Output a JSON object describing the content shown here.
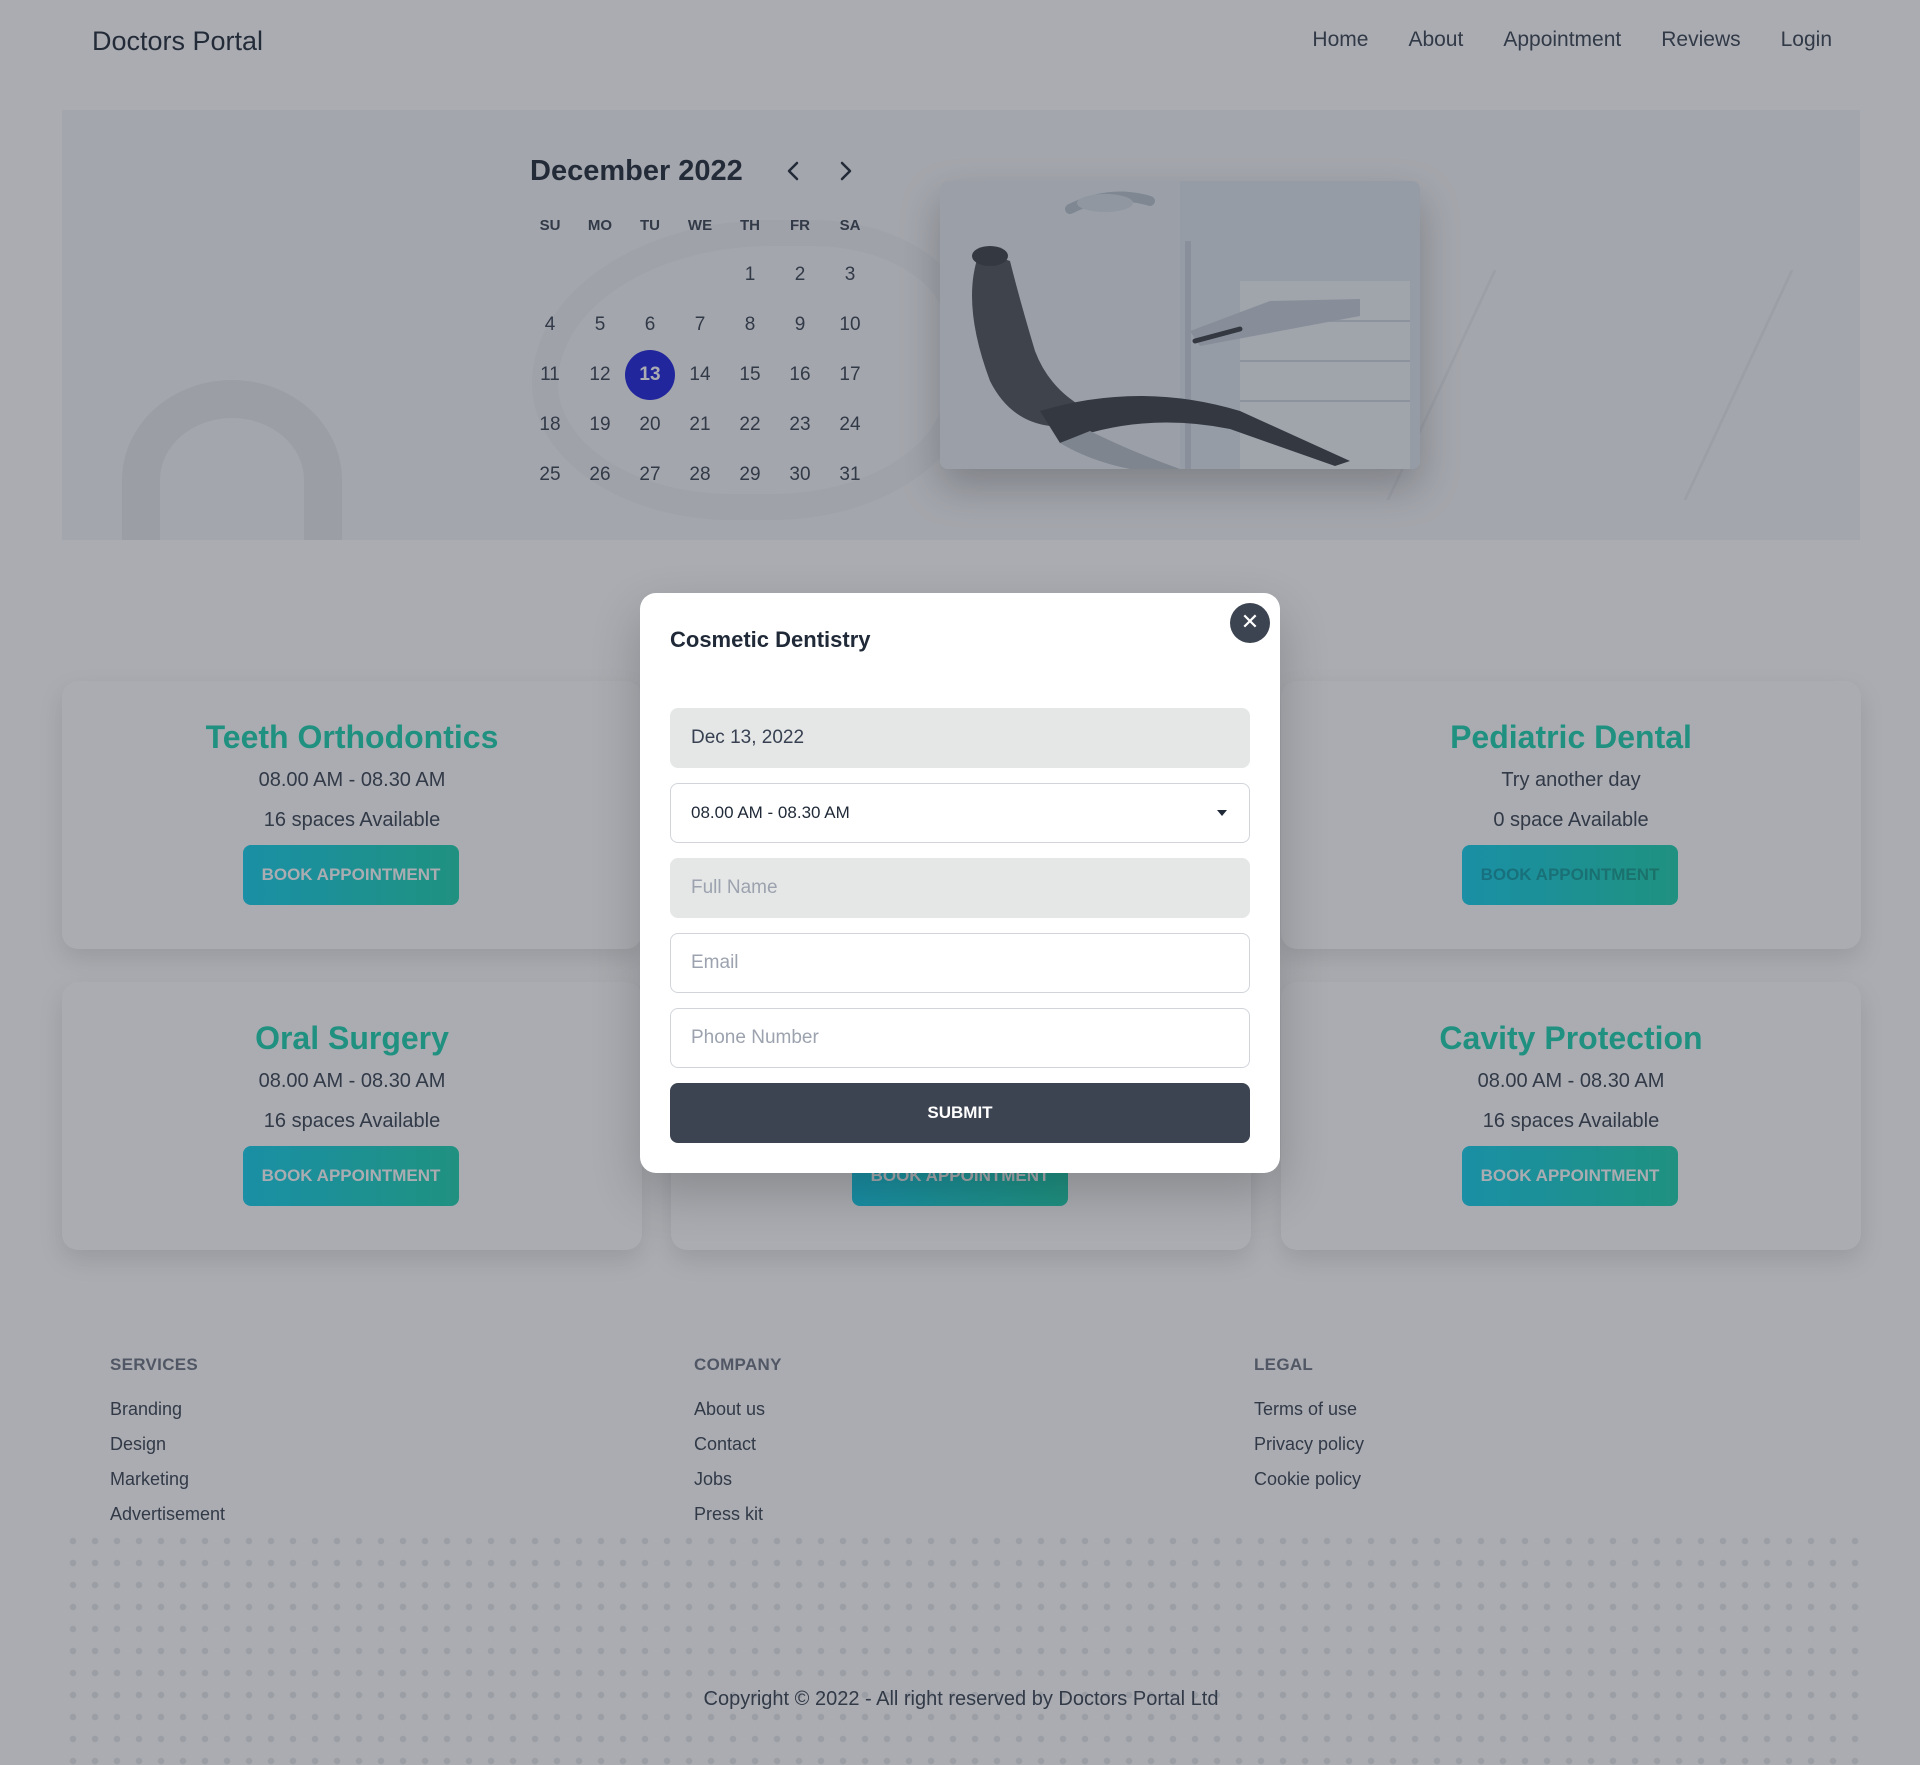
{
  "navbar": {
    "brand": "Doctors Portal",
    "links": [
      "Home",
      "About",
      "Appointment",
      "Reviews",
      "Login"
    ]
  },
  "calendar": {
    "month_label": "December 2022",
    "weekdays": [
      "SU",
      "MO",
      "TU",
      "WE",
      "TH",
      "FR",
      "SA"
    ],
    "first_weekday_index": 4,
    "days_in_month": 31,
    "selected_day": 13
  },
  "services": [
    {
      "title": "Teeth Orthodontics",
      "time": "08.00 AM - 08.30 AM",
      "spaces": "16 spaces Available",
      "button": "BOOK APPOINTMENT",
      "disabled": false
    },
    {
      "title": "Pediatric Dental",
      "time": "Try another day",
      "spaces": "0 space Available",
      "button": "BOOK APPOINTMENT",
      "disabled": true
    },
    {
      "title": "Oral Surgery",
      "time": "08.00 AM - 08.30 AM",
      "spaces": "16 spaces Available",
      "button": "BOOK APPOINTMENT",
      "disabled": false
    },
    {
      "title": "",
      "time": "",
      "spaces": "",
      "button": "BOOK APPOINTMENT",
      "disabled": false
    },
    {
      "title": "Cavity Protection",
      "time": "08.00 AM - 08.30 AM",
      "spaces": "16 spaces Available",
      "button": "BOOK APPOINTMENT",
      "disabled": false
    }
  ],
  "modal": {
    "title": "Cosmetic Dentistry",
    "close_symbol": "✕",
    "date_value": "Dec 13, 2022",
    "slot_value": "08.00 AM - 08.30 AM",
    "name_placeholder": "Full Name",
    "email_placeholder": "Email",
    "phone_placeholder": "Phone Number",
    "submit_label": "SUBMIT"
  },
  "footer": {
    "services": {
      "heading": "SERVICES",
      "links": [
        "Branding",
        "Design",
        "Marketing",
        "Advertisement"
      ]
    },
    "company": {
      "heading": "COMPANY",
      "links": [
        "About us",
        "Contact",
        "Jobs",
        "Press kit"
      ]
    },
    "legal": {
      "heading": "LEGAL",
      "links": [
        "Terms of use",
        "Privacy policy",
        "Cookie policy"
      ]
    },
    "copyright": "Copyright © 2022 - All right reserved by Doctors Portal Ltd"
  },
  "colors": {
    "accent_text": "#19d3ae",
    "gradient_start": "#0fcfec",
    "gradient_end": "#19d3ae",
    "selected_day": "#1c20dd",
    "dark_button": "#3d4451"
  },
  "icons": {
    "calendar_prev": "chevron-left-icon",
    "calendar_next": "chevron-right-icon",
    "modal_close": "close-icon",
    "select_arrow": "caret-down-icon"
  }
}
